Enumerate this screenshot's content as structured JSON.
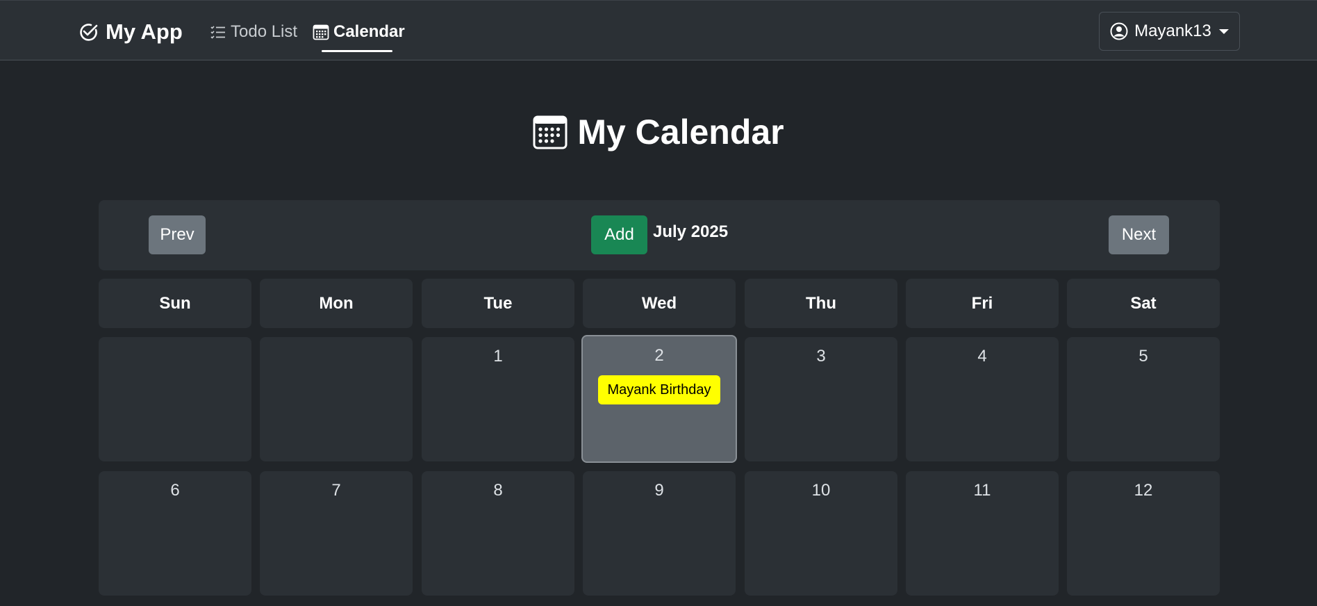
{
  "navbar": {
    "brand": "My App",
    "links": [
      {
        "label": "Todo List",
        "icon": "list-check-icon"
      },
      {
        "label": "Calendar",
        "icon": "calendar-icon",
        "active": true
      }
    ],
    "user": {
      "name": "Mayank13",
      "icon": "user-circle-icon"
    }
  },
  "page": {
    "title": "My Calendar",
    "icon": "calendar-icon"
  },
  "toolbar": {
    "prev_label": "Prev",
    "add_label": "Add",
    "month_label": "July 2025",
    "next_label": "Next"
  },
  "weekdays": [
    "Sun",
    "Mon",
    "Tue",
    "Wed",
    "Thu",
    "Fri",
    "Sat"
  ],
  "weeks": [
    [
      "",
      "",
      "1",
      "2",
      "3",
      "4",
      "5"
    ],
    [
      "6",
      "7",
      "8",
      "9",
      "10",
      "11",
      "12"
    ]
  ],
  "selected_day": "2",
  "events": [
    {
      "day": "2",
      "title": "Mayank Birthday",
      "color": "#ffff00"
    }
  ],
  "colors": {
    "background": "#212529",
    "surface": "#2b3035",
    "add_button": "#198754",
    "nav_buttons": "#6c757d",
    "selected_day": "#5c636a"
  }
}
